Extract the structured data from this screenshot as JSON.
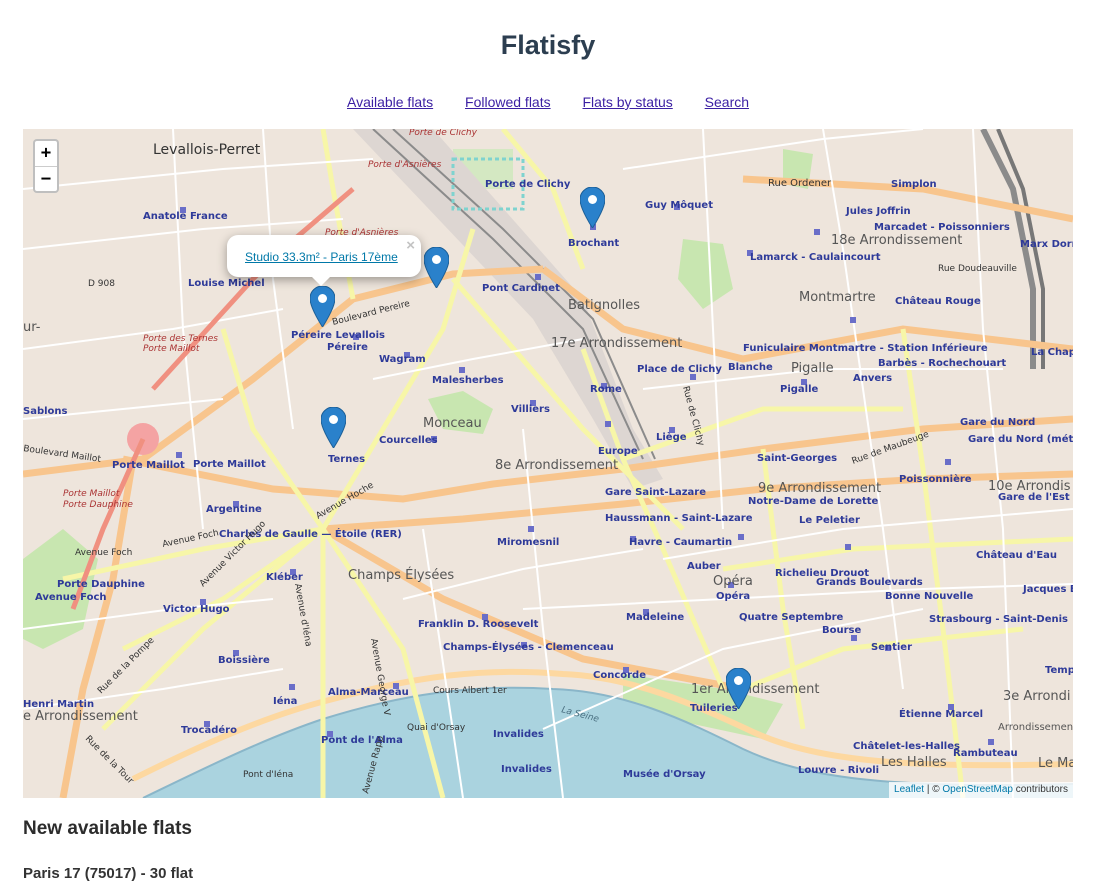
{
  "app_title": "Flatisfy",
  "nav": {
    "available": "Available flats",
    "followed": "Followed flats",
    "by_status": "Flats by status",
    "search": "Search"
  },
  "map": {
    "zoom_in": "+",
    "zoom_out": "−",
    "popup": {
      "text": "Studio 33.3m² - Paris 17ème",
      "close": "×"
    },
    "attribution": {
      "leaflet": "Leaflet",
      "separator": " | © ",
      "osm": "OpenStreetMap",
      "suffix": " contributors"
    },
    "marker_color": "#2a81cb",
    "labels": {
      "levallois": "Levallois-Perret",
      "anatole": "Anatole France",
      "louise": "Louise Michel",
      "d908": "D 908",
      "porte_asnieres": "Porte d'Asnières",
      "porte_clichy_top": "Porte de Clichy",
      "porte_clichy": "Porte de Clichy",
      "asnieres": "Porte d'Asnières",
      "brochant": "Brochant",
      "guy_moquet": "Guy Môquet",
      "rue_ordener": "Rue Ordener",
      "simplon": "Simplon",
      "jules_joffrin": "Jules Joffrin",
      "marcadet": "Marcadet - Poissonniers",
      "arr18": "18e Arrondissement",
      "marx_dormoy": "Marx Dorm",
      "lamarck": "Lamarck - Caulaincourt",
      "rue_doudeauville": "Rue Doudeauville",
      "pont_cardinet": "Pont Cardinet",
      "batignolles": "Batignolles",
      "montmartre": "Montmartre",
      "chateau_rouge": "Château Rouge",
      "pereire_levallois": "Péreire Levallois",
      "pereire": "Péreire",
      "boulevard_pereire": "Boulevard Pereire",
      "arr17": "17e Arrondissement",
      "funiculaire": "Funiculaire Montmartre - Station Inférieure",
      "la_chapelle": "La Chape",
      "porte_des_ternes": "Porte des Ternes",
      "porte_maillot_top": "Porte Maillot",
      "wagram": "Wagram",
      "malesherbes": "Malesherbes",
      "place_clichy": "Place de Clichy",
      "blanche": "Blanche",
      "pigalle_big": "Pigalle",
      "pigalle": "Pigalle",
      "barbes": "Barbès - Rochechouart",
      "anvers": "Anvers",
      "rome": "Rome",
      "sablons": "Sablons",
      "monceau": "Monceau",
      "villiers": "Villiers",
      "courcelles": "Courcelles",
      "liege": "Liège",
      "rue_clichy": "Rue de Clichy",
      "gare_du_nord": "Gare du Nord",
      "gare_du_nord_metro": "Gare du Nord (métro",
      "boulevard_maillot": "Boulevard Maillot",
      "ternes": "Ternes",
      "europe": "Europe",
      "arr8": "8e Arrondissement",
      "saint_georges": "Saint-Georges",
      "rue_maubeuge": "Rue de Maubeuge",
      "porte_maillot": "Porte Maillot",
      "porte_maillot2": "Porte Maillot",
      "poissonniere": "Poissonnière",
      "arr9": "9e Arrondissement",
      "arr10": "10e Arrondis",
      "gare_saint_lazare": "Gare Saint-Lazare",
      "notre_dame_lorette": "Notre-Dame de Lorette",
      "gare_est": "Gare de l'Est",
      "porte_maillot3": "Porte Maillot",
      "porte_dauphine_red": "Porte Dauphine",
      "argentine": "Argentine",
      "avenue_hoche": "Avenue Hoche",
      "haussmann": "Haussmann - Saint-Lazare",
      "le_peletier": "Le Peletier",
      "charles_de_gaulle": "Charles de Gaulle — Étoile (RER)",
      "miromesnil": "Miromesnil",
      "havre": "Havre - Caumartin",
      "chateau_eau": "Château d'Eau",
      "avenue_foch": "Avenue Foch",
      "avenue_foch2": "Avenue Foch",
      "avenue_victor_hugo": "Avenue Victor Hugo",
      "kleber": "Kléber",
      "champs_elysees": "Champs Élysées",
      "auber": "Auber",
      "richelieu": "Richelieu Drouot",
      "grands_boulevards": "Grands Boulevards",
      "porte_dauphine": "Porte Dauphine",
      "avenue_foch3": "Avenue Foch",
      "opera_big": "Opéra",
      "opera": "Opéra",
      "bonne_nouvelle": "Bonne Nouvelle",
      "jacques_bon": "Jacques Bon",
      "victor_hugo": "Victor Hugo",
      "avenue_iena": "Avenue d'Iéna",
      "madeleine": "Madeleine",
      "quatre_septembre": "Quatre Septembre",
      "strasbourg": "Strasbourg - Saint-Denis",
      "franklin": "Franklin D. Roosevelt",
      "bourse": "Bourse",
      "sentier": "Sentier",
      "boissiere": "Boissière",
      "champs_clemenceau": "Champs-Élysées - Clemenceau",
      "temple": "Templ",
      "rue_pompe": "Rue de la Pompe",
      "concorde": "Concorde",
      "arr1": "1er Arrondissement",
      "alma_marceau": "Alma-Marceau",
      "cours_albert": "Cours Albert 1er",
      "arr3": "3e Arrondi",
      "henri_martin": "Henri Martin",
      "iena": "Iéna",
      "la_seine": "La Seine",
      "tuileries": "Tuileries",
      "etienne_marcel": "Étienne Marcel",
      "arr16": "e Arrondissement",
      "arr_right": "Arrondissement",
      "rue_tour": "Rue de la Tour",
      "trocadero": "Trocadéro",
      "quai_orsay": "Quai d'Orsay",
      "invalides": "Invalides",
      "chatelet": "Châtelet-les-Halles",
      "rambuteau": "Rambuteau",
      "les_halles": "Les Halles",
      "pont_alma": "Pont de l'Alma",
      "avenue_rapp": "Avenue Rapp",
      "invalides2": "Invalides",
      "musee_orsay": "Musée d'Orsay",
      "louvre": "Louvre - Rivoli",
      "pont_iena": "Pont d'Iéna",
      "le_ma": "Le Ma",
      "george_v": "Avenue George V",
      "ur": "ur-"
    }
  },
  "section_title": "New available flats",
  "group_title": "Paris 17 (75017) - 30 flat"
}
